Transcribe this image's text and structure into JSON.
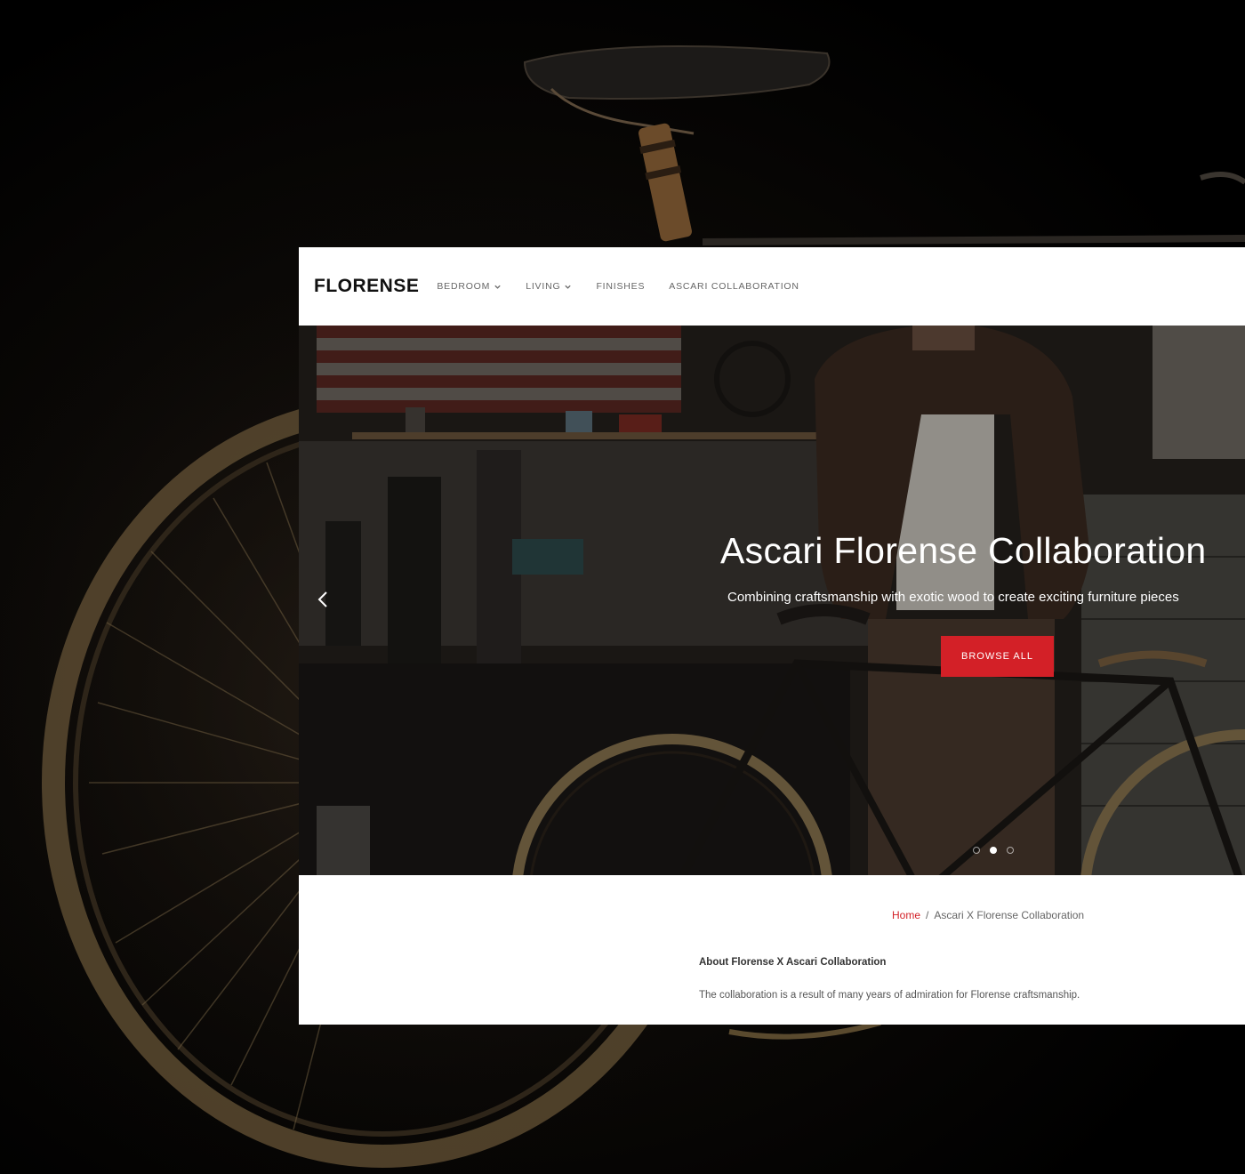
{
  "brand": {
    "logo_text": "FLORENSE"
  },
  "nav": {
    "items": [
      {
        "label": "BEDROOM",
        "has_dropdown": true
      },
      {
        "label": "LIVING",
        "has_dropdown": true
      },
      {
        "label": "FINISHES",
        "has_dropdown": false
      },
      {
        "label": "ASCARI COLLABORATION",
        "has_dropdown": false
      }
    ]
  },
  "hero": {
    "title": "Ascari Florense Collaboration",
    "subtitle": "Combining craftsmanship with exotic wood to create exciting furniture pieces",
    "button_label": "BROWSE ALL",
    "prev_icon": "chevron-left-icon",
    "slide_count": 3,
    "active_slide": 2
  },
  "breadcrumb": {
    "home": "Home",
    "separator": "/",
    "current": "Ascari X Florense Collaboration"
  },
  "about": {
    "title": "About Florense X Ascari Collaboration",
    "text": "The collaboration is a result of many years of admiration for Florense craftsmanship."
  },
  "colors": {
    "accent": "#d32027",
    "page_background": "#000000",
    "window_background": "#ffffff"
  }
}
